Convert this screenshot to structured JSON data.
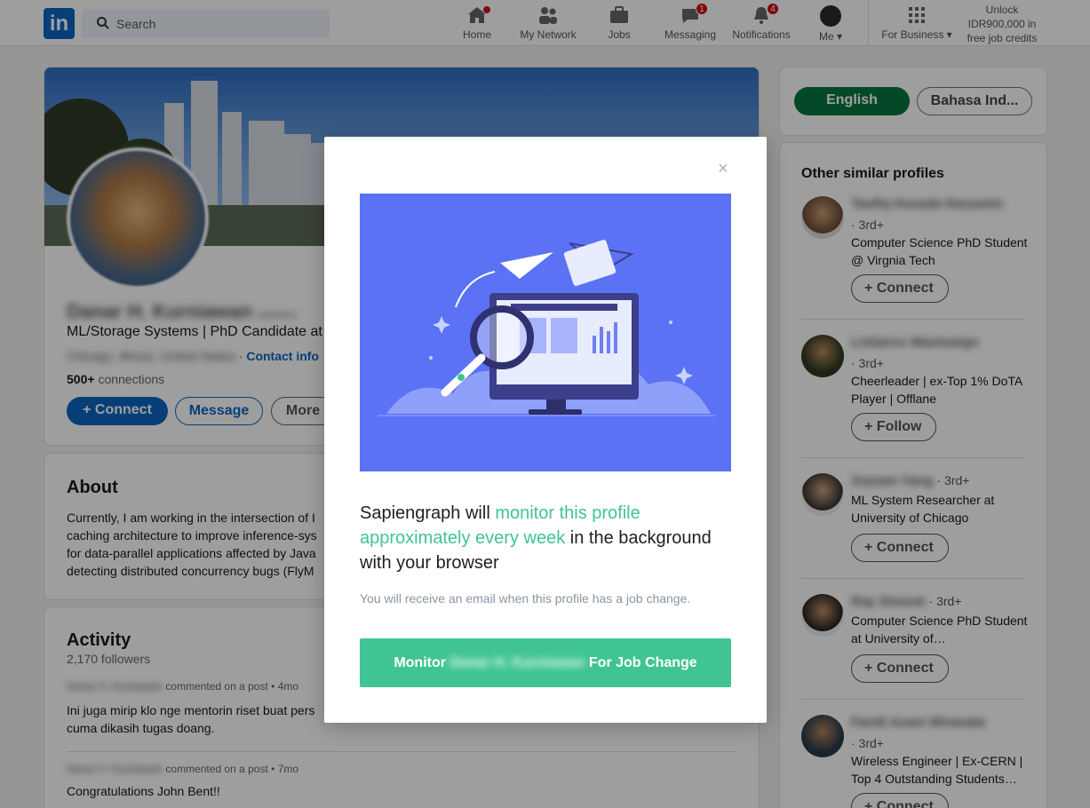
{
  "nav": {
    "search_placeholder": "Search",
    "items": [
      {
        "label": "Home",
        "icon": "home-icon",
        "badge": ""
      },
      {
        "label": "My Network",
        "icon": "network-icon",
        "badge": ""
      },
      {
        "label": "Jobs",
        "icon": "briefcase-icon",
        "badge": ""
      },
      {
        "label": "Messaging",
        "icon": "messaging-icon",
        "badge": "1"
      },
      {
        "label": "Notifications",
        "icon": "bell-icon",
        "badge": "4"
      },
      {
        "label": "Me ▾",
        "icon": "avatar-icon",
        "badge": ""
      },
      {
        "label": "For Business ▾",
        "icon": "grid-icon",
        "badge": ""
      }
    ],
    "unlock_text": "Unlock IDR900,000 in free job credits"
  },
  "profile": {
    "name": "Danar H. Kurniawan",
    "pronouns": "(He/Him)",
    "headline": "ML/Storage Systems | PhD Candidate at",
    "location": "Chicago, Illinois, United States",
    "contact_info": "Contact info",
    "connections_count": "500+",
    "connections_label": "connections",
    "connect_label": "Connect",
    "message_label": "Message",
    "more_label": "More"
  },
  "about": {
    "title": "About",
    "lines": [
      "Currently, I am working in the intersection of I",
      "caching architecture to improve inference-sys",
      "for data-parallel applications affected by Java",
      "detecting distributed concurrency bugs (FlyM"
    ]
  },
  "activity": {
    "title": "Activity",
    "followers": "2,170 followers",
    "posts": [
      {
        "author": "Danar H. Kurniawan",
        "action": "commented on a post",
        "time": "• 4mo",
        "text_lines": [
          "Ini juga mirip klo nge mentorin riset buat pers",
          "cuma dikasih tugas doang."
        ]
      },
      {
        "author": "Danar H. Kurniawan",
        "action": "commented on a post",
        "time": "• 7mo",
        "text_lines": [
          "Congratulations John Bent!!"
        ]
      }
    ]
  },
  "language": {
    "english": "English",
    "bahasa": "Bahasa Ind..."
  },
  "similar": {
    "title": "Other similar profiles",
    "profiles": [
      {
        "name": "Taufiq Husada Daryanto",
        "degree": "· 3rd+",
        "headline": "Computer Science PhD Student @ Virgnia Tech",
        "action": "Connect"
      },
      {
        "name": "Listiarso Wastuargo",
        "degree": "· 3rd+",
        "headline": "Cheerleader | ex-Top 1% DoTA Player | Offlane",
        "action": "Follow"
      },
      {
        "name": "Zeyuan Yang",
        "degree": "· 3rd+",
        "headline": "ML System Researcher at University of Chicago",
        "action": "Connect"
      },
      {
        "name": "Ray Sinurat",
        "degree": "· 3rd+",
        "headline": "Computer Science PhD Student at University of…",
        "action": "Connect"
      },
      {
        "name": "Fandi Azam Wiranata",
        "degree": "· 3rd+",
        "headline": "Wireless Engineer | Ex-CERN | Top 4 Outstanding Students…",
        "action": "Connect"
      }
    ]
  },
  "modal": {
    "close": "×",
    "title_pre": "Sapiengraph will ",
    "title_highlight": "monitor this profile approximately every week",
    "title_post": " in the background with your browser",
    "subtitle": "You will receive an email when this profile has a job change.",
    "button_pre": "Monitor",
    "button_name": "Danar H. Kurniawan",
    "button_post": "For Job Change"
  },
  "colors": {
    "linkedin_blue": "#0a66c2",
    "sapiengraph_green": "#41c493",
    "illustration_bg": "#5b72f5",
    "english_button": "#057642"
  }
}
